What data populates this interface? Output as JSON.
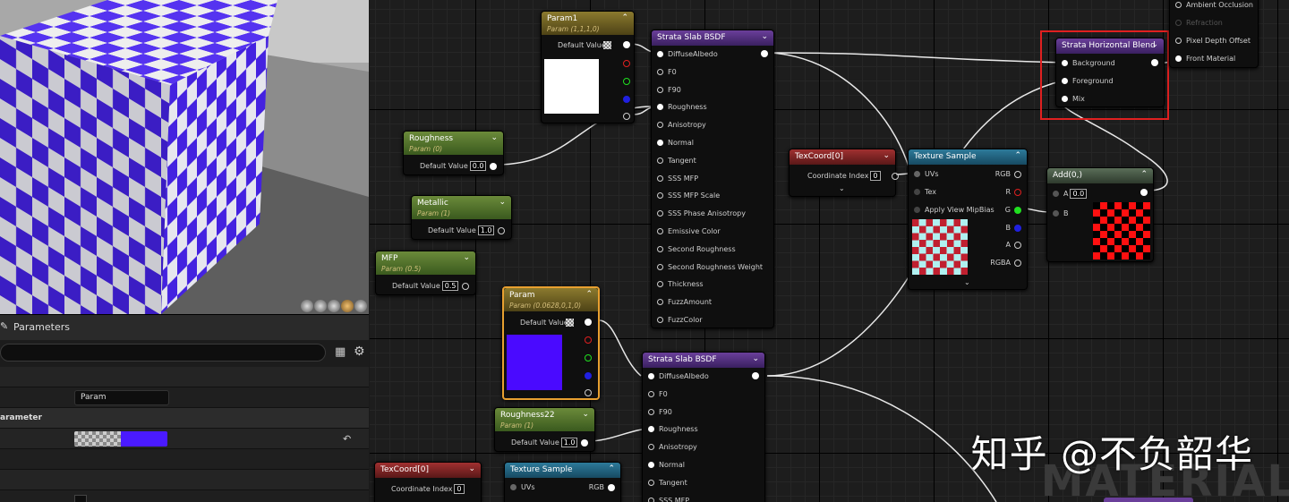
{
  "viewport": {
    "view_mode_icons": [
      "sphere-icon",
      "plane-icon",
      "cylinder-icon",
      "cube-icon",
      "teapot-icon"
    ]
  },
  "params": {
    "title": "Parameters",
    "param_value": "Param",
    "group_label": "arameter",
    "color_accent": "#4a1aff",
    "reset_icon": "↶"
  },
  "nodes": {
    "param1": {
      "title": "Param1",
      "sub": "Param (1,1,1,0)",
      "default_label": "Default Value"
    },
    "roughness": {
      "title": "Roughness",
      "sub": "Param (0)",
      "default_label": "Default Value",
      "value": "0.0"
    },
    "metallic": {
      "title": "Metallic",
      "sub": "Param (1)",
      "default_label": "Default Value",
      "value": "1.0"
    },
    "mfp": {
      "title": "MFP",
      "sub": "Param (0.5)",
      "default_label": "Default Value",
      "value": "0.5"
    },
    "param": {
      "title": "Param",
      "sub": "Param (0.0628,0,1,0)",
      "default_label": "Default Value"
    },
    "roughness22": {
      "title": "Roughness22",
      "sub": "Param (1)",
      "default_label": "Default Value",
      "value": "1.0"
    },
    "slab1": {
      "title": "Strata Slab BSDF",
      "pins": [
        "DiffuseAlbedo",
        "F0",
        "F90",
        "Roughness",
        "Anisotropy",
        "Normal",
        "Tangent",
        "SSS MFP",
        "SSS MFP Scale",
        "SSS Phase Anisotropy",
        "Emissive Color",
        "Second Roughness",
        "Second Roughness Weight",
        "Thickness",
        "FuzzAmount",
        "FuzzColor"
      ]
    },
    "slab2": {
      "title": "Strata Slab BSDF",
      "pins": [
        "DiffuseAlbedo",
        "F0",
        "F90",
        "Roughness",
        "Anisotropy",
        "Normal",
        "Tangent",
        "SSS MFP"
      ]
    },
    "texcoord1": {
      "title": "TexCoord[0]",
      "label": "Coordinate Index",
      "value": "0"
    },
    "texcoord2": {
      "title": "TexCoord[0]",
      "label": "Coordinate Index",
      "value": "0"
    },
    "texsample1": {
      "title": "Texture Sample",
      "inputs": [
        "UVs",
        "Tex",
        "Apply View MipBias"
      ],
      "outputs": [
        "RGB",
        "R",
        "G",
        "B",
        "A",
        "RGBA"
      ]
    },
    "texsample2": {
      "title": "Texture Sample",
      "inputs": [
        "UVs"
      ],
      "outputs": [
        "RGB"
      ]
    },
    "add": {
      "title": "Add(0,)",
      "a_label": "A",
      "a_value": "0.0",
      "b_label": "B"
    },
    "hblend": {
      "title": "Strata Horizontal Blend",
      "pins": [
        "Background",
        "Foreground",
        "Mix"
      ]
    },
    "result": {
      "pins": [
        "Ambient Occlusion",
        "Refraction",
        "Pixel Depth Offset",
        "Front Material"
      ]
    }
  },
  "watermark": "知乎 @不负韶华",
  "bg_watermark": "MATERIAL"
}
